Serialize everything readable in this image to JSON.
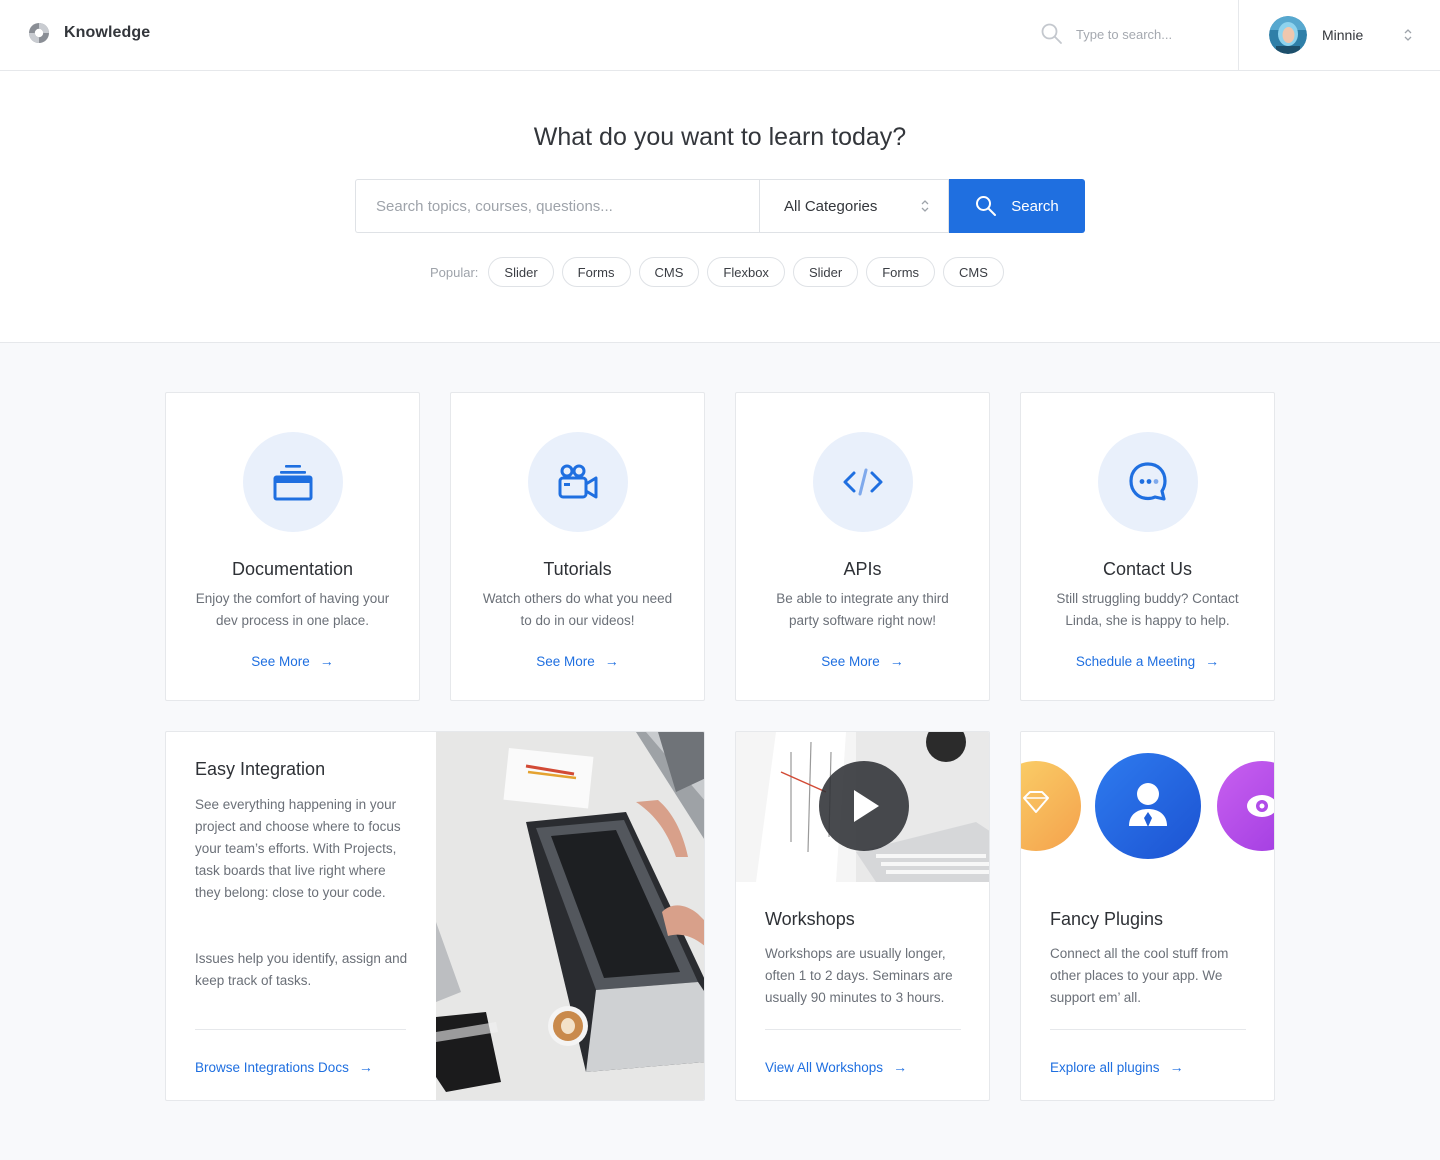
{
  "header": {
    "brand_name": "Knowledge",
    "search_placeholder": "Type to search...",
    "user_name": "Minnie"
  },
  "hero": {
    "title": "What do you want to learn today?",
    "search_placeholder": "Search topics, courses, questions...",
    "category_selected": "All Categories",
    "search_button": "Search",
    "popular_label": "Popular:",
    "popular_tags": [
      "Slider",
      "Forms",
      "CMS",
      "Flexbox",
      "Slider",
      "Forms",
      "CMS"
    ]
  },
  "features": [
    {
      "title": "Documentation",
      "description": "Enjoy the comfort of having your dev process in one place.",
      "link": "See More",
      "icon": "archive-icon"
    },
    {
      "title": "Tutorials",
      "description": "Watch others do what you need to do in our videos!",
      "link": "See More",
      "icon": "video-camera-icon"
    },
    {
      "title": "APIs",
      "description": "Be able to integrate any third party software right now!",
      "link": "See More",
      "icon": "code-icon"
    },
    {
      "title": "Contact Us",
      "description": "Still struggling buddy? Contact Linda, she is happy to help.",
      "link": "Schedule a Meeting",
      "icon": "chat-bubble-icon"
    }
  ],
  "integration": {
    "title": "Easy Integration",
    "paragraph1": "See everything happening in your project and choose where to focus your team’s efforts. With Projects, task boards that live right where they belong: close to your code.",
    "paragraph2": "Issues help you identify, assign and keep track of tasks.",
    "link": "Browse Integrations Docs"
  },
  "workshops": {
    "title": "Workshops",
    "description": "Workshops are usually longer, often 1 to 2 days. Seminars are usually 90 minutes to 3 hours.",
    "link": "View All Workshops"
  },
  "plugins": {
    "title": "Fancy Plugins",
    "description": "Connect all the cool stuff from other places to your app. We support em’ all.",
    "link": "Explore all plugins"
  },
  "link_arrow": "→",
  "colors": {
    "accent": "#1f6fe0",
    "icon_bg": "#e9f0fb",
    "plugin_orange": "#f7b955",
    "plugin_blue": "#1f63de",
    "plugin_purple": "#b94fe6"
  }
}
